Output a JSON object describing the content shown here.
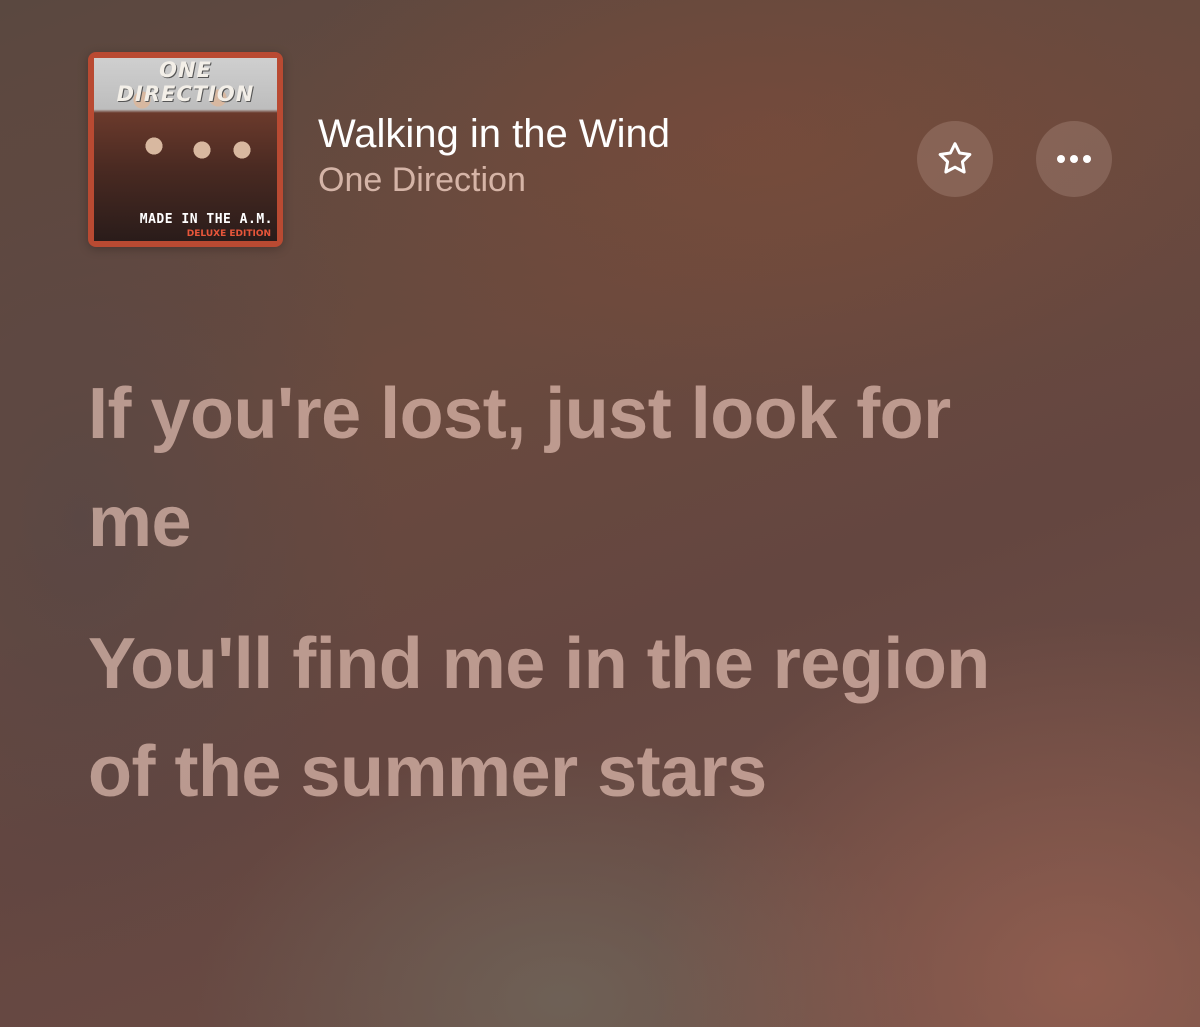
{
  "header": {
    "album_art": {
      "band_text": "ONE DIRECTION",
      "album_title": "MADE IN THE A.M.",
      "edition": "DELUXE EDITION"
    },
    "song_title": "Walking in the Wind",
    "artist": "One Direction",
    "favorite_icon": "star-outline-icon",
    "more_icon": "ellipsis-icon"
  },
  "lyrics": {
    "lines": [
      "If you're lost, just look for me",
      "You'll find me in the region of the summer stars"
    ]
  },
  "colors": {
    "background": "#6a4a3e",
    "title": "#ffffff",
    "artist": "#e8cfc4",
    "lyric": "#d9b8ad"
  }
}
